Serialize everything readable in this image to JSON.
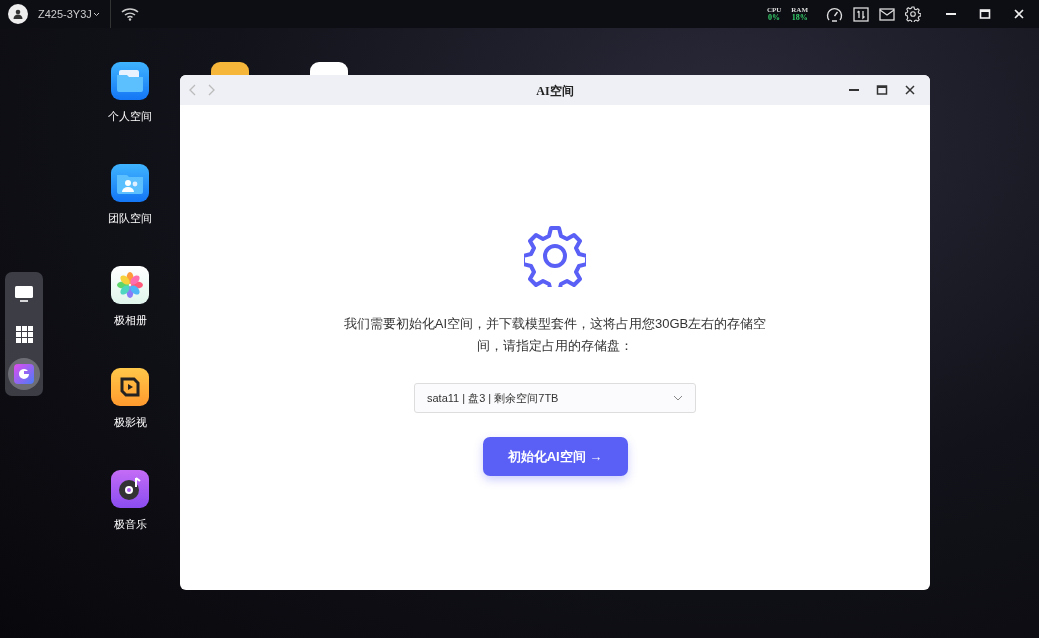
{
  "top_bar": {
    "device_name": "Z425-3Y3J",
    "cpu": {
      "label": "CPU",
      "value": "0%"
    },
    "ram": {
      "label": "RAM",
      "value": "18%"
    }
  },
  "desktop_icons": [
    {
      "label": "个人空间",
      "kind": "folder"
    },
    {
      "label": "团队空间",
      "kind": "team"
    },
    {
      "label": "极相册",
      "kind": "photos"
    },
    {
      "label": "极影视",
      "kind": "video"
    },
    {
      "label": "极音乐",
      "kind": "music"
    }
  ],
  "dock": [
    {
      "kind": "monitor",
      "selected": false
    },
    {
      "kind": "apps",
      "selected": false
    },
    {
      "kind": "ai",
      "selected": true
    }
  ],
  "window": {
    "title": "AI空间",
    "message": "我们需要初始化AI空间，并下载模型套件，这将占用您30GB左右的存储空间，请指定占用的存储盘：",
    "disk_select": {
      "value": "sata11 | 盘3 | 剩余空间7TB"
    },
    "button": "初始化AI空间 →"
  }
}
